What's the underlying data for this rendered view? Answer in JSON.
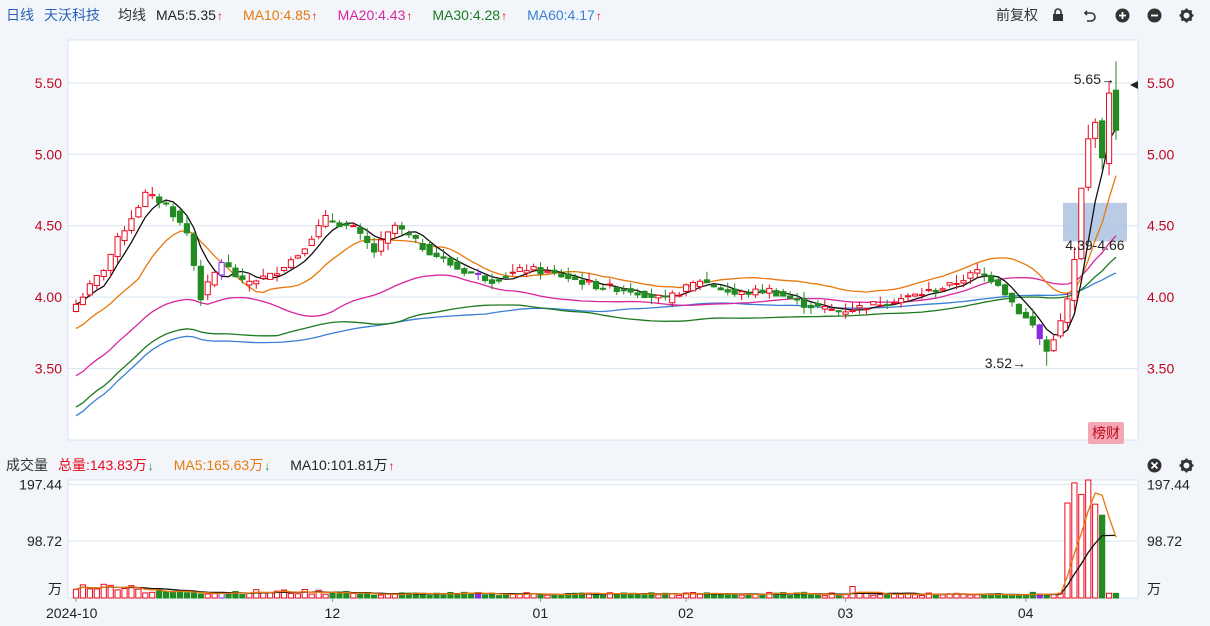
{
  "header": {
    "period": "日线",
    "stock_name": "天沃科技",
    "ma_label": "均线",
    "ma_items": [
      {
        "label": "MA5:5.35",
        "color": "#222222",
        "trend": "up"
      },
      {
        "label": "MA10:4.85",
        "color": "#e8780e",
        "trend": "up"
      },
      {
        "label": "MA20:4.43",
        "color": "#d9259c",
        "trend": "up"
      },
      {
        "label": "MA30:4.28",
        "color": "#1e7a1e",
        "trend": "up"
      },
      {
        "label": "MA60:4.17",
        "color": "#3a7fd6",
        "trend": "up"
      }
    ],
    "adjust": "前复权",
    "icons": [
      "lock-icon",
      "undo-icon",
      "zoom-in-icon",
      "zoom-out-icon",
      "gear-icon"
    ]
  },
  "volume_header": {
    "label": "成交量",
    "items": [
      {
        "label": "总量:143.83万",
        "color": "#e8091e",
        "trend": "down"
      },
      {
        "label": "MA5:165.63万",
        "color": "#e8780e",
        "trend": "down"
      },
      {
        "label": "MA10:101.81万",
        "color": "#222222",
        "trend": "up"
      }
    ],
    "icons": [
      "close-icon",
      "gear-icon"
    ]
  },
  "badge": "榜财",
  "colors": {
    "up": "#e8091e",
    "down": "#228b22",
    "special": "#8a2be2",
    "grid": "#d6e4f0",
    "ma5": "#111111",
    "ma10": "#e8780e",
    "ma20": "#d9259c",
    "ma30": "#1e7a1e",
    "ma60": "#3a7fd6"
  },
  "chart_data": {
    "type": "candlestick",
    "y_ticks": [
      "5.50",
      "5.00",
      "4.50",
      "4.00",
      "3.50"
    ],
    "ylim": [
      3.0,
      5.8
    ],
    "annotations": {
      "high": "5.65→",
      "low": "3.52→",
      "range": "4.39-4.66"
    },
    "range_band": [
      4.39,
      4.66
    ],
    "volume_ticks": [
      "197.44",
      "98.72",
      "万"
    ],
    "volume_ylim": [
      0,
      205
    ],
    "x_labels": [
      {
        "label": "2024-10",
        "index": 0
      },
      {
        "label": "12",
        "index": 37
      },
      {
        "label": "01",
        "index": 67
      },
      {
        "label": "02",
        "index": 88
      },
      {
        "label": "03",
        "index": 111
      },
      {
        "label": "04",
        "index": 137
      }
    ],
    "key_closes": [
      [
        0,
        3.95
      ],
      [
        4,
        4.2
      ],
      [
        6,
        4.4
      ],
      [
        10,
        4.72
      ],
      [
        13,
        4.65
      ],
      [
        16,
        4.45
      ],
      [
        18,
        4.0
      ],
      [
        21,
        4.25
      ],
      [
        24,
        4.1
      ],
      [
        28,
        4.15
      ],
      [
        32,
        4.3
      ],
      [
        36,
        4.55
      ],
      [
        40,
        4.48
      ],
      [
        43,
        4.32
      ],
      [
        46,
        4.5
      ],
      [
        50,
        4.35
      ],
      [
        55,
        4.2
      ],
      [
        60,
        4.12
      ],
      [
        65,
        4.2
      ],
      [
        70,
        4.15
      ],
      [
        75,
        4.08
      ],
      [
        80,
        4.05
      ],
      [
        85,
        3.98
      ],
      [
        90,
        4.12
      ],
      [
        95,
        4.02
      ],
      [
        100,
        4.05
      ],
      [
        105,
        3.95
      ],
      [
        110,
        3.9
      ],
      [
        115,
        3.95
      ],
      [
        120,
        4.0
      ],
      [
        126,
        4.08
      ],
      [
        130,
        4.18
      ],
      [
        133,
        4.1
      ],
      [
        136,
        3.9
      ],
      [
        138,
        3.8
      ],
      [
        140,
        3.62
      ],
      [
        142,
        3.82
      ],
      [
        143,
        3.98
      ],
      [
        144,
        4.25
      ],
      [
        145,
        4.75
      ],
      [
        146,
        5.1
      ],
      [
        147,
        5.25
      ],
      [
        148,
        4.95
      ],
      [
        149,
        5.45
      ],
      [
        150,
        5.15
      ]
    ],
    "ma_last": {
      "ma5": 5.35,
      "ma10": 4.85,
      "ma20": 4.43,
      "ma30": 4.28,
      "ma60": 4.17
    },
    "ma_first": {
      "ma5": 3.95,
      "ma10": 3.78,
      "ma20": 3.45,
      "ma30": 3.23,
      "ma60": 3.17
    },
    "volume_spikes": [
      [
        143,
        165
      ],
      [
        144,
        200
      ],
      [
        145,
        180
      ],
      [
        146,
        205
      ],
      [
        147,
        163
      ],
      [
        148,
        143.83
      ]
    ]
  }
}
